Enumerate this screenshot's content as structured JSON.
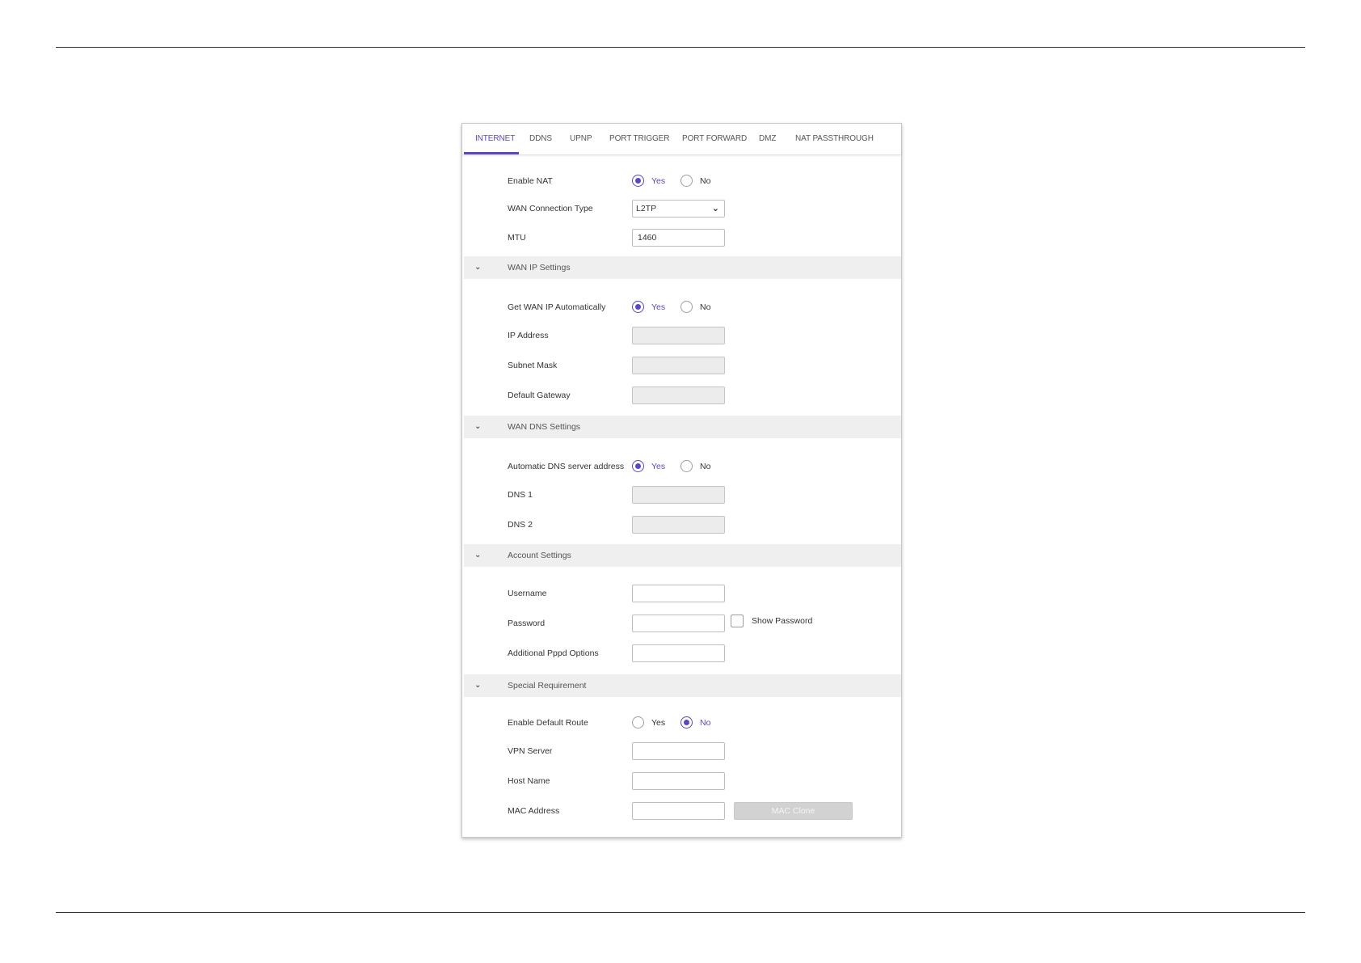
{
  "tabs": [
    {
      "label": "INTERNET",
      "active": true
    },
    {
      "label": "DDNS"
    },
    {
      "label": "UPNP"
    },
    {
      "label": "PORT TRIGGER"
    },
    {
      "label": "PORT FORWARD"
    },
    {
      "label": "DMZ"
    },
    {
      "label": "NAT PASSTHROUGH"
    }
  ],
  "accent_color": "#5b46c8",
  "general": {
    "enable_nat_label": "Enable NAT",
    "enable_nat_value": "Yes",
    "wan_type_label": "WAN Connection Type",
    "wan_type_value": "L2TP",
    "mtu_label": "MTU",
    "mtu_value": "1460"
  },
  "options": {
    "yes": "Yes",
    "no": "No"
  },
  "wan_ip": {
    "title": "WAN IP Settings",
    "auto_label": "Get WAN IP Automatically",
    "auto_value": "Yes",
    "ip_label": "IP Address",
    "mask_label": "Subnet Mask",
    "gateway_label": "Default Gateway"
  },
  "wan_dns": {
    "title": "WAN DNS Settings",
    "auto_label": "Automatic DNS server address",
    "auto_value": "Yes",
    "dns1_label": "DNS 1",
    "dns2_label": "DNS 2"
  },
  "account": {
    "title": "Account Settings",
    "username_label": "Username",
    "password_label": "Password",
    "show_password_label": "Show Password",
    "pppd_label": "Additional Pppd Options"
  },
  "special": {
    "title": "Special Requirement",
    "default_route_label": "Enable Default Route",
    "default_route_value": "No",
    "vpn_label": "VPN Server",
    "host_label": "Host Name",
    "mac_label": "MAC Address",
    "mac_clone_label": "MAC Clone"
  },
  "icons": {
    "chevron": "chevron-down-icon"
  }
}
